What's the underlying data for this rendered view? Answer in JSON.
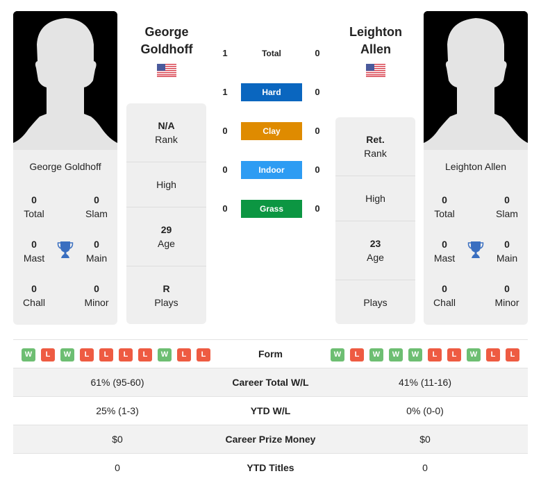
{
  "players": {
    "left": {
      "name": "George Goldhoff",
      "name_line1": "George",
      "name_line2": "Goldhoff",
      "country_flag": "us-flag-icon",
      "photo": "silhouette-placeholder",
      "titles": {
        "total": {
          "value": "0",
          "label": "Total"
        },
        "slam": {
          "value": "0",
          "label": "Slam"
        },
        "mast": {
          "value": "0",
          "label": "Mast"
        },
        "main": {
          "value": "0",
          "label": "Main"
        },
        "chall": {
          "value": "0",
          "label": "Chall"
        },
        "minor": {
          "value": "0",
          "label": "Minor"
        }
      },
      "info": {
        "rank": {
          "value": "N/A",
          "label": "Rank"
        },
        "high": {
          "value": "",
          "label": "High"
        },
        "age": {
          "value": "29",
          "label": "Age"
        },
        "plays": {
          "value": "R",
          "label": "Plays"
        }
      },
      "form": [
        "W",
        "L",
        "W",
        "L",
        "L",
        "L",
        "L",
        "W",
        "L",
        "L"
      ]
    },
    "right": {
      "name": "Leighton Allen",
      "name_line1": "Leighton",
      "name_line2": "Allen",
      "country_flag": "us-flag-icon",
      "photo": "silhouette-placeholder",
      "titles": {
        "total": {
          "value": "0",
          "label": "Total"
        },
        "slam": {
          "value": "0",
          "label": "Slam"
        },
        "mast": {
          "value": "0",
          "label": "Mast"
        },
        "main": {
          "value": "0",
          "label": "Main"
        },
        "chall": {
          "value": "0",
          "label": "Chall"
        },
        "minor": {
          "value": "0",
          "label": "Minor"
        }
      },
      "info": {
        "rank": {
          "value": "Ret.",
          "label": "Rank"
        },
        "high": {
          "value": "",
          "label": "High"
        },
        "age": {
          "value": "23",
          "label": "Age"
        },
        "plays": {
          "value": "",
          "label": "Plays"
        }
      },
      "form": [
        "W",
        "L",
        "W",
        "W",
        "W",
        "L",
        "L",
        "W",
        "L",
        "L"
      ]
    }
  },
  "h2h": [
    {
      "label": "Total",
      "left": "1",
      "right": "0",
      "color": null
    },
    {
      "label": "Hard",
      "left": "1",
      "right": "0",
      "color": "#0a66bf"
    },
    {
      "label": "Clay",
      "left": "0",
      "right": "0",
      "color": "#df8b00"
    },
    {
      "label": "Indoor",
      "left": "0",
      "right": "0",
      "color": "#2d9cf3"
    },
    {
      "label": "Grass",
      "left": "0",
      "right": "0",
      "color": "#0c9642"
    }
  ],
  "comparison": {
    "form_label": "Form",
    "rows": [
      {
        "label": "Career Total W/L",
        "left": "61% (95-60)",
        "right": "41% (11-16)"
      },
      {
        "label": "YTD W/L",
        "left": "25% (1-3)",
        "right": "0% (0-0)"
      },
      {
        "label": "Career Prize Money",
        "left": "$0",
        "right": "$0"
      },
      {
        "label": "YTD Titles",
        "left": "0",
        "right": "0"
      }
    ]
  },
  "colors": {
    "win": "#6dbe72",
    "loss": "#ee5b42",
    "trophy": "#3a6fc0",
    "card_bg": "#efefef"
  }
}
